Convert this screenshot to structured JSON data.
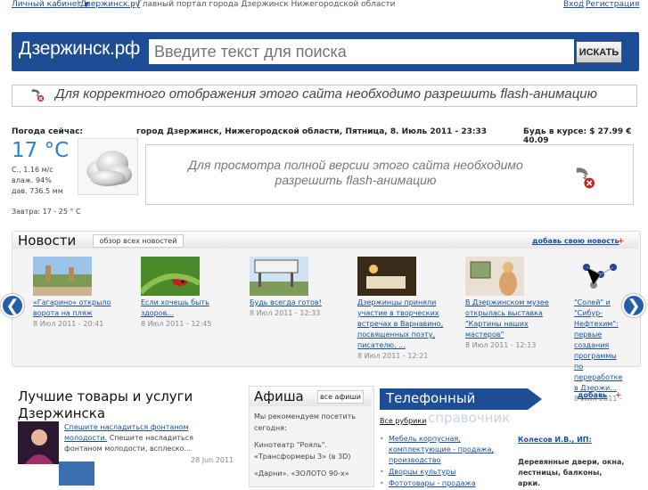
{
  "topbar": {
    "cabinet": "Личный кабинет",
    "site_link": "Дзержинск.ру",
    "separator": "|",
    "tagline": "- Главный портал города Дзержинск Нижегородской области",
    "login": "Вход",
    "register": "Регистрация"
  },
  "header": {
    "logo": "Дзержинск.рф",
    "search_placeholder": "Введите текст для поиска",
    "search_button": "ИСКАТЬ"
  },
  "flash_notice": "Для корректного отображения этого сайта необходимо разрешить flash-анимацию",
  "weather": {
    "title": "Погода сейчас:",
    "temperature": "17 °C",
    "wind": "С., 1.16 м/с",
    "humidity": "влаж. 94%",
    "pressure": "дав. 736.5 мм",
    "tomorrow": "Завтра: 17 - 25 ° C"
  },
  "city_line": "город Дзержинск, Нижегородской области, Пятница, 8. Июль 2011 - 23:33",
  "rates": "Будь в курсе: $ 27.99 € 40.09",
  "flash_box": "Для просмотра полной версии этого сайта необходимо разрешить flash-анимацию",
  "news": {
    "title": "Новости",
    "all_tab": "обзор всех новостей",
    "add_link": "добавь свою новость",
    "add_plus": "+",
    "prev": "❮",
    "next": "❯",
    "items": [
      {
        "text": "«Гагарино» открыло ворота на пляж",
        "date": "8 Июл 2011 - 20:41"
      },
      {
        "text": "Если хочешь быть здоров...",
        "date": "8 Июл 2011 - 12:45"
      },
      {
        "text": "Будь всегда готов!",
        "date": "8 Июл 2011 - 12:33"
      },
      {
        "text": "Дзержинцы приняли участие в творческих встречах в Варнавино, посвященных поэту, писателю, ...",
        "date": "8 Июл 2011 - 12:21"
      },
      {
        "text": "В Дзержинском музее открылась выставка \"Картины наших мастеров\"",
        "date": "8 Июл 2011 - 12:13"
      },
      {
        "text": "\"Солей\" и \"Сибур-Нефтехим\": первые создания программы по переработке в Дзержи...",
        "date": "8 Июл 2011 -"
      }
    ]
  },
  "goods": {
    "title": "Лучшие товары и услуги Дзержинска",
    "link": "Спешите насладиться фонтаном молодости.",
    "text": " Спешите насладиться фонтаном молодости, всплеско...",
    "date": "28 Jun 2011"
  },
  "afisha": {
    "title": "Афиша",
    "all_tab": "все афиши",
    "intro": "Мы рекомендуем посетить сегодня:",
    "line1": "Кинотеатр \"Рояль\". «Трансформеры 3» (в 3D)",
    "line2": "«Дарни». «ЗОЛОТО 90-х»"
  },
  "phones": {
    "title": "Телефонный",
    "ghost": "справочник",
    "add_link": "добавь",
    "add_plus": "+",
    "rubrics_title": "Все рубрики",
    "rubrics": [
      "Мебель корпусная, комплектующие - продажа, производство",
      "Дворцы культуры",
      "Фототовары - продажа"
    ],
    "company": "Колесов И.В., ИП:",
    "company_desc": "Деревянные двери, окна, лестницы, балконы, арки."
  },
  "colors": {
    "brand_blue": "#1c4d95",
    "link": "#1a4f9c",
    "temperature": "#2b82c8"
  }
}
